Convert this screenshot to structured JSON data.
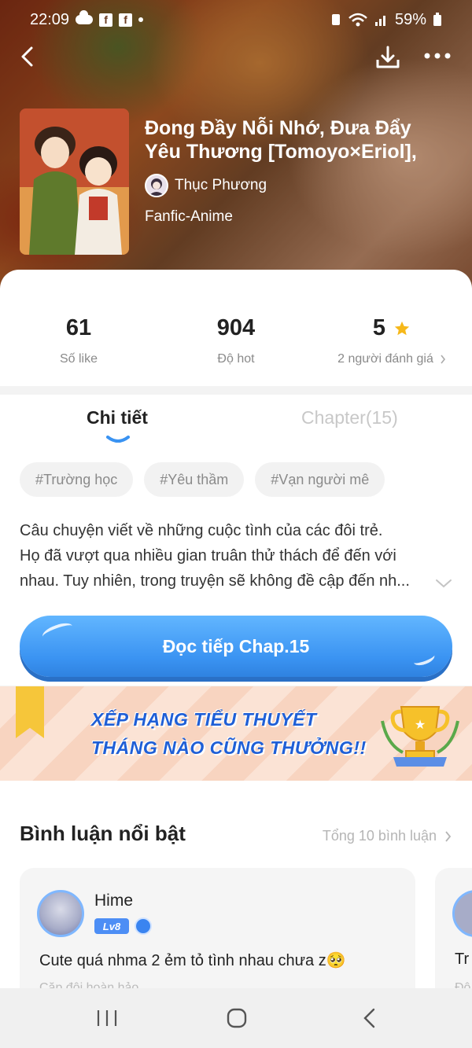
{
  "status_bar": {
    "time": "22:09",
    "battery": "59%"
  },
  "book": {
    "title_line1": "Đong Đầy Nỗi Nhớ, Đưa Đẩy",
    "title_line2": "Yêu Thương [Tomoyo×Eriol],",
    "author": "Thục Phương",
    "genre": "Fanfic-Anime"
  },
  "stats": {
    "likes": {
      "value": "61",
      "label": "Số like"
    },
    "hot": {
      "value": "904",
      "label": "Độ hot"
    },
    "rating": {
      "value": "5",
      "label": "2 người đánh giá"
    }
  },
  "tabs": {
    "detail": "Chi tiết",
    "chapters": "Chapter(15)"
  },
  "tags": [
    "#Trường học",
    "#Yêu thầm",
    "#Vạn người mê"
  ],
  "description": [
    "Câu chuyện viết về những cuộc tình của các đôi trẻ.",
    "Họ đã vượt qua nhiều gian truân thử thách để đến với",
    "nhau.  Tuy nhiên, trong truyện sẽ không đề cập đến nh..."
  ],
  "read_button": "Đọc tiếp Chap.15",
  "banner": {
    "line1": "XẾP HẠNG TIỂU THUYẾT",
    "line2": "THÁNG NÀO CŨNG THƯỞNG!!"
  },
  "comments": {
    "heading": "Bình luận nổi bật",
    "total": "Tổng 10 bình luận",
    "items": [
      {
        "name": "Hime",
        "level": "Lv8",
        "text": "Cute quá nhma 2 ẻm tỏ tình nhau chưa z🥺",
        "sub": "Cặp đôi hoàn hảo"
      },
      {
        "text": "Tr",
        "sub": "Đô"
      }
    ]
  },
  "colors": {
    "accent": "#3a93f2",
    "star": "#f6b81a",
    "banner_text": "#1f5fd6"
  },
  "icons": [
    "back-icon",
    "download-icon",
    "more-icon",
    "star-icon",
    "chevron-right-icon",
    "chevron-down-icon",
    "trophy-icon",
    "recent-apps-icon",
    "home-icon",
    "nav-back-icon"
  ]
}
